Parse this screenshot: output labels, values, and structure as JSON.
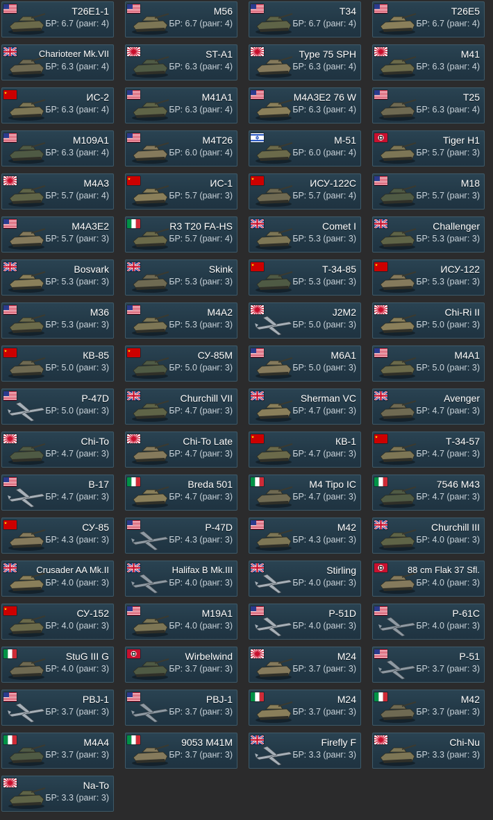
{
  "columns": 4,
  "items": [
    {
      "name": "T26E1-1",
      "br": "БР: 6.7 (ранг: 4)",
      "country": "usa",
      "type": "tank"
    },
    {
      "name": "M56",
      "br": "БР: 6.7 (ранг: 4)",
      "country": "usa",
      "type": "tank"
    },
    {
      "name": "T34",
      "br": "БР: 6.7 (ранг: 4)",
      "country": "usa",
      "type": "tank"
    },
    {
      "name": "T26E5",
      "br": "БР: 6.7 (ранг: 4)",
      "country": "usa",
      "type": "tank"
    },
    {
      "name": "Charioteer Mk.VII",
      "br": "БР: 6.3 (ранг: 4)",
      "country": "uk",
      "type": "tank"
    },
    {
      "name": "ST-A1",
      "br": "БР: 6.3 (ранг: 4)",
      "country": "japan",
      "type": "tank"
    },
    {
      "name": "Type 75 SPH",
      "br": "БР: 6.3 (ранг: 4)",
      "country": "japan",
      "type": "tank"
    },
    {
      "name": "M41",
      "br": "БР: 6.3 (ранг: 4)",
      "country": "japan",
      "type": "tank"
    },
    {
      "name": "ИС-2",
      "br": "БР: 6.3 (ранг: 4)",
      "country": "ussr",
      "type": "tank"
    },
    {
      "name": "M41A1",
      "br": "БР: 6.3 (ранг: 4)",
      "country": "usa",
      "type": "tank"
    },
    {
      "name": "M4A3E2 76 W",
      "br": "БР: 6.3 (ранг: 4)",
      "country": "usa",
      "type": "tank"
    },
    {
      "name": "T25",
      "br": "БР: 6.3 (ранг: 4)",
      "country": "usa",
      "type": "tank"
    },
    {
      "name": "M109A1",
      "br": "БР: 6.3 (ранг: 4)",
      "country": "usa",
      "type": "tank"
    },
    {
      "name": "M4T26",
      "br": "БР: 6.0 (ранг: 4)",
      "country": "usa",
      "type": "tank"
    },
    {
      "name": "M-51",
      "br": "БР: 6.0 (ранг: 4)",
      "country": "israel",
      "type": "tank"
    },
    {
      "name": "Tiger H1",
      "br": "БР: 5.7 (ранг: 3)",
      "country": "germany",
      "type": "tank"
    },
    {
      "name": "M4A3",
      "br": "БР: 5.7 (ранг: 4)",
      "country": "japan",
      "type": "tank"
    },
    {
      "name": "ИС-1",
      "br": "БР: 5.7 (ранг: 3)",
      "country": "ussr",
      "type": "tank"
    },
    {
      "name": "ИСУ-122С",
      "br": "БР: 5.7 (ранг: 4)",
      "country": "ussr",
      "type": "tank"
    },
    {
      "name": "M18",
      "br": "БР: 5.7 (ранг: 3)",
      "country": "usa",
      "type": "tank"
    },
    {
      "name": "M4A3E2",
      "br": "БР: 5.7 (ранг: 3)",
      "country": "usa",
      "type": "tank"
    },
    {
      "name": "R3 T20 FA-HS",
      "br": "БР: 5.7 (ранг: 4)",
      "country": "italy",
      "type": "tank"
    },
    {
      "name": "Comet I",
      "br": "БР: 5.3 (ранг: 3)",
      "country": "uk",
      "type": "tank"
    },
    {
      "name": "Challenger",
      "br": "БР: 5.3 (ранг: 3)",
      "country": "uk",
      "type": "tank"
    },
    {
      "name": "Bosvark",
      "br": "БР: 5.3 (ранг: 3)",
      "country": "uk",
      "type": "tank"
    },
    {
      "name": "Skink",
      "br": "БР: 5.3 (ранг: 3)",
      "country": "uk",
      "type": "tank"
    },
    {
      "name": "Т-34-85",
      "br": "БР: 5.3 (ранг: 3)",
      "country": "ussr",
      "type": "tank"
    },
    {
      "name": "ИСУ-122",
      "br": "БР: 5.3 (ранг: 3)",
      "country": "ussr",
      "type": "tank"
    },
    {
      "name": "M36",
      "br": "БР: 5.3 (ранг: 3)",
      "country": "usa",
      "type": "tank"
    },
    {
      "name": "M4A2",
      "br": "БР: 5.3 (ранг: 3)",
      "country": "usa",
      "type": "tank"
    },
    {
      "name": "J2M2",
      "br": "БР: 5.0 (ранг: 3)",
      "country": "japan",
      "type": "plane"
    },
    {
      "name": "Chi-Ri II",
      "br": "БР: 5.0 (ранг: 3)",
      "country": "japan",
      "type": "tank"
    },
    {
      "name": "КВ-85",
      "br": "БР: 5.0 (ранг: 3)",
      "country": "ussr",
      "type": "tank"
    },
    {
      "name": "СУ-85М",
      "br": "БР: 5.0 (ранг: 3)",
      "country": "ussr",
      "type": "tank"
    },
    {
      "name": "M6A1",
      "br": "БР: 5.0 (ранг: 3)",
      "country": "usa",
      "type": "tank"
    },
    {
      "name": "M4A1",
      "br": "БР: 5.0 (ранг: 3)",
      "country": "usa",
      "type": "tank"
    },
    {
      "name": "P-47D",
      "br": "БР: 5.0 (ранг: 3)",
      "country": "usa",
      "type": "plane"
    },
    {
      "name": "Churchill VII",
      "br": "БР: 4.7 (ранг: 3)",
      "country": "uk",
      "type": "tank"
    },
    {
      "name": "Sherman VC",
      "br": "БР: 4.7 (ранг: 3)",
      "country": "uk",
      "type": "tank"
    },
    {
      "name": "Avenger",
      "br": "БР: 4.7 (ранг: 3)",
      "country": "uk",
      "type": "tank"
    },
    {
      "name": "Chi-To",
      "br": "БР: 4.7 (ранг: 3)",
      "country": "japan",
      "type": "tank"
    },
    {
      "name": "Chi-To Late",
      "br": "БР: 4.7 (ранг: 3)",
      "country": "japan",
      "type": "tank"
    },
    {
      "name": "КВ-1",
      "br": "БР: 4.7 (ранг: 3)",
      "country": "ussr",
      "type": "tank"
    },
    {
      "name": "Т-34-57",
      "br": "БР: 4.7 (ранг: 3)",
      "country": "ussr",
      "type": "tank"
    },
    {
      "name": "B-17",
      "br": "БР: 4.7 (ранг: 3)",
      "country": "usa",
      "type": "plane"
    },
    {
      "name": "Breda 501",
      "br": "БР: 4.7 (ранг: 3)",
      "country": "italy",
      "type": "tank"
    },
    {
      "name": "M4 Tipo IC",
      "br": "БР: 4.7 (ранг: 3)",
      "country": "italy",
      "type": "tank"
    },
    {
      "name": "7546 M43",
      "br": "БР: 4.7 (ранг: 3)",
      "country": "italy",
      "type": "tank"
    },
    {
      "name": "СУ-85",
      "br": "БР: 4.3 (ранг: 3)",
      "country": "ussr",
      "type": "tank"
    },
    {
      "name": "P-47D",
      "br": "БР: 4.3 (ранг: 3)",
      "country": "usa",
      "type": "plane"
    },
    {
      "name": "M42",
      "br": "БР: 4.3 (ранг: 3)",
      "country": "usa",
      "type": "tank"
    },
    {
      "name": "Churchill III",
      "br": "БР: 4.0 (ранг: 3)",
      "country": "uk",
      "type": "tank"
    },
    {
      "name": "Crusader AA Mk.II",
      "br": "БР: 4.0 (ранг: 3)",
      "country": "uk",
      "type": "tank"
    },
    {
      "name": "Halifax B Mk.III",
      "br": "БР: 4.0 (ранг: 3)",
      "country": "uk",
      "type": "plane"
    },
    {
      "name": "Stirling",
      "br": "БР: 4.0 (ранг: 3)",
      "country": "uk",
      "type": "plane"
    },
    {
      "name": "88 cm Flak 37 Sfl.",
      "br": "БР: 4.0 (ранг: 3)",
      "country": "germany",
      "type": "tank"
    },
    {
      "name": "СУ-152",
      "br": "БР: 4.0 (ранг: 3)",
      "country": "ussr",
      "type": "tank"
    },
    {
      "name": "M19A1",
      "br": "БР: 4.0 (ранг: 3)",
      "country": "usa",
      "type": "tank"
    },
    {
      "name": "P-51D",
      "br": "БР: 4.0 (ранг: 3)",
      "country": "usa",
      "type": "plane"
    },
    {
      "name": "P-61C",
      "br": "БР: 4.0 (ранг: 3)",
      "country": "usa",
      "type": "plane"
    },
    {
      "name": "StuG III G",
      "br": "БР: 4.0 (ранг: 3)",
      "country": "italy",
      "type": "tank"
    },
    {
      "name": "Wirbelwind",
      "br": "БР: 3.7 (ранг: 3)",
      "country": "germany",
      "type": "tank"
    },
    {
      "name": "M24",
      "br": "БР: 3.7 (ранг: 3)",
      "country": "japan",
      "type": "tank"
    },
    {
      "name": "P-51",
      "br": "БР: 3.7 (ранг: 3)",
      "country": "usa",
      "type": "plane"
    },
    {
      "name": "PBJ-1",
      "br": "БР: 3.7 (ранг: 3)",
      "country": "usa",
      "type": "plane"
    },
    {
      "name": "PBJ-1",
      "br": "БР: 3.7 (ранг: 3)",
      "country": "usa",
      "type": "plane"
    },
    {
      "name": "M24",
      "br": "БР: 3.7 (ранг: 3)",
      "country": "italy",
      "type": "tank"
    },
    {
      "name": "M42",
      "br": "БР: 3.7 (ранг: 3)",
      "country": "italy",
      "type": "tank"
    },
    {
      "name": "M4A4",
      "br": "БР: 3.7 (ранг: 3)",
      "country": "italy",
      "type": "tank"
    },
    {
      "name": "9053 M41M",
      "br": "БР: 3.7 (ранг: 3)",
      "country": "italy",
      "type": "tank"
    },
    {
      "name": "Firefly F",
      "br": "БР: 3.3 (ранг: 3)",
      "country": "uk",
      "type": "plane"
    },
    {
      "name": "Chi-Nu",
      "br": "БР: 3.3 (ранг: 3)",
      "country": "japan",
      "type": "tank"
    },
    {
      "name": "Na-To",
      "br": "БР: 3.3 (ранг: 3)",
      "country": "japan",
      "type": "tank"
    }
  ]
}
